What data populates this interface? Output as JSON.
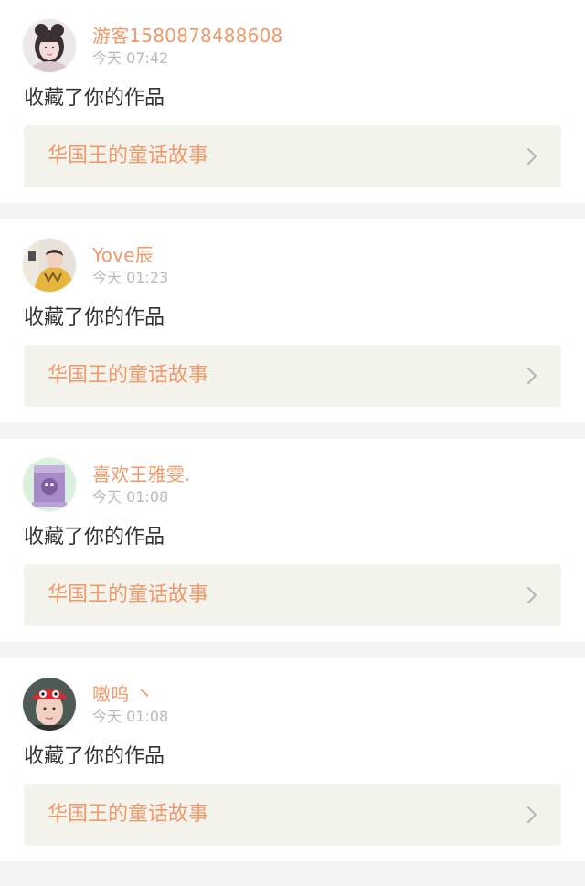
{
  "notifications": [
    {
      "username": "游客1580878488608",
      "time": "今天 07:42",
      "action": "收藏了你的作品",
      "work_title": "华国王的童话故事",
      "avatar_icon": "avatar-girl-icon"
    },
    {
      "username": "Yove辰",
      "time": "今天 01:23",
      "action": "收藏了你的作品",
      "work_title": "华国王的童话故事",
      "avatar_icon": "avatar-yellow-jacket-icon"
    },
    {
      "username": "喜欢王雅雯.",
      "time": "今天 01:08",
      "action": "收藏了你的作品",
      "work_title": "华国王的童话故事",
      "avatar_icon": "avatar-purple-drink-icon"
    },
    {
      "username": "嗷呜 丶",
      "time": "今天 01:08",
      "action": "收藏了你的作品",
      "work_title": "华国王的童话故事",
      "avatar_icon": "avatar-red-hat-icon"
    }
  ],
  "colors": {
    "accent": "#ef9a6a",
    "link_background": "#f3f3ec",
    "page_background": "#f4f4f4",
    "time_text": "#b9b9b9",
    "body_text": "#333333"
  },
  "icons": {
    "chevron": "chevron-right-icon"
  }
}
